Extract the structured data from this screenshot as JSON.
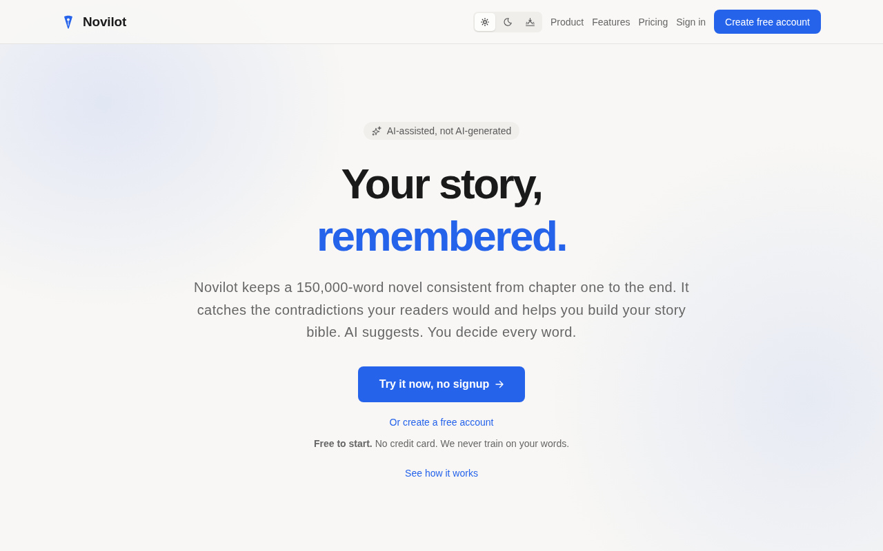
{
  "header": {
    "logo": "Novilot",
    "theme_options": [
      {
        "kind": "light",
        "selected": true
      },
      {
        "kind": "dark",
        "selected": false
      },
      {
        "kind": "sunset",
        "selected": false
      }
    ],
    "nav": [
      "Product",
      "Features",
      "Pricing",
      "Sign in"
    ],
    "cta": "Create free account"
  },
  "hero": {
    "badge": "AI-assisted, not AI-generated",
    "headline": "Your story,",
    "headline_accent": "remembered.",
    "description": "Novilot keeps a 150,000-word novel consistent from chapter one to the end. It catches the contradictions your readers would and helps you build your story bible. AI suggests. You decide every word.",
    "primary_button": "Try it now, no signup",
    "secondary_link": "Or create a free account",
    "note": "**Free to start.** No credit card. We never train on your words.",
    "tertiary_link": "See how it works"
  }
}
